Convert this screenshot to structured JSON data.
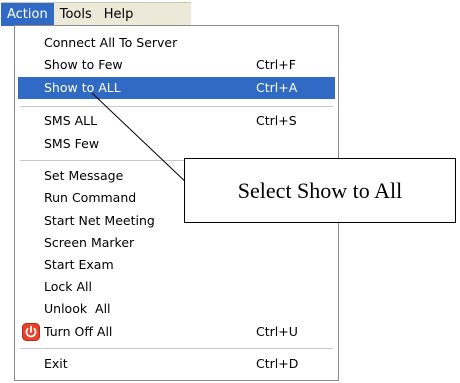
{
  "menubar": {
    "items": [
      {
        "label": "Action"
      },
      {
        "label": "Tools"
      },
      {
        "label": "Help"
      }
    ]
  },
  "menu": {
    "items": [
      {
        "label": "Connect All To Server",
        "shortcut": ""
      },
      {
        "label": "Show to Few",
        "shortcut": "Ctrl+F"
      },
      {
        "label": "Show to ALL",
        "shortcut": "Ctrl+A"
      },
      {
        "label": "SMS ALL",
        "shortcut": "Ctrl+S"
      },
      {
        "label": "SMS Few",
        "shortcut": ""
      },
      {
        "label": "Set Message",
        "shortcut": ""
      },
      {
        "label": "Run Command",
        "shortcut": ""
      },
      {
        "label": "Start Net Meeting",
        "shortcut": ""
      },
      {
        "label": "Screen Marker",
        "shortcut": ""
      },
      {
        "label": "Start Exam",
        "shortcut": ""
      },
      {
        "label": "Lock All",
        "shortcut": ""
      },
      {
        "label": "Unlook  All",
        "shortcut": ""
      },
      {
        "label": "Turn Off All",
        "shortcut": "Ctrl+U",
        "icon": "power-icon"
      },
      {
        "label": "Exit",
        "shortcut": "Ctrl+D"
      }
    ],
    "highlighted": "Show to ALL"
  },
  "callout": {
    "text": "Select Show to All"
  },
  "colors": {
    "highlight": "#316ac5",
    "menubar_bg": "#ece9d8",
    "power_icon": "#e8422a"
  }
}
